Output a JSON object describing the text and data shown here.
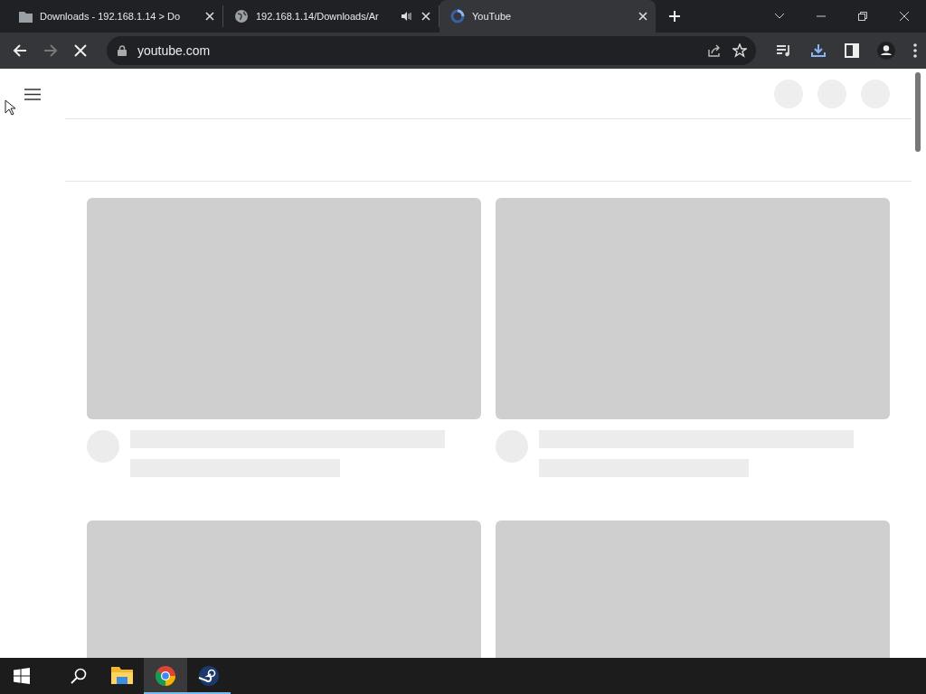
{
  "browser": {
    "tabs": [
      {
        "title": "Downloads - 192.168.1.14 > Do",
        "audio": false,
        "selected": false
      },
      {
        "title": "192.168.1.14/Downloads/Ar",
        "audio": true,
        "selected": false
      },
      {
        "title": "YouTube",
        "audio": false,
        "selected": true
      }
    ],
    "address": "youtube.com",
    "loading": true
  },
  "page": {
    "cards": [
      {
        "kind": "skeleton"
      },
      {
        "kind": "skeleton"
      },
      {
        "kind": "thumbnail"
      },
      {
        "kind": "thumbnail"
      }
    ]
  },
  "taskbar": {
    "apps": [
      {
        "kind": "files",
        "running": false,
        "selected": false
      },
      {
        "kind": "chrome",
        "running": true,
        "selected": true
      },
      {
        "kind": "steam",
        "running": true,
        "selected": false
      }
    ]
  }
}
